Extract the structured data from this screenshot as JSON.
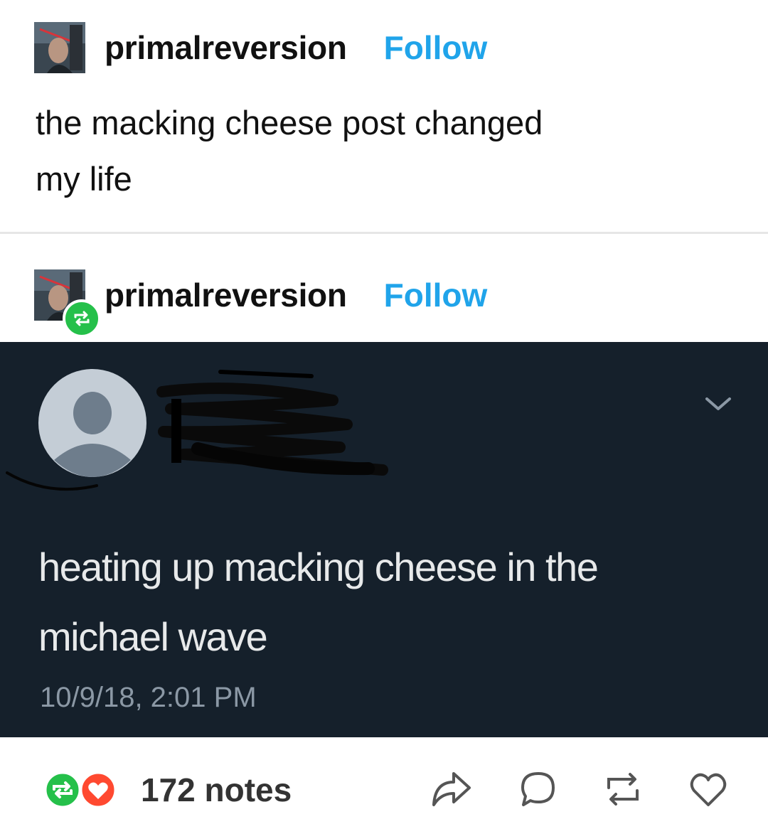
{
  "post": {
    "username": "primalreversion",
    "follow_label": "Follow",
    "text_line1": "the macking cheese post changed",
    "text_line2": "my life"
  },
  "reblog": {
    "username": "primalreversion",
    "follow_label": "Follow"
  },
  "tweet": {
    "text_line1": "heating up macking cheese in the",
    "text_line2": "michael wave",
    "timestamp": "10/9/18, 2:01 PM"
  },
  "footer": {
    "notes": "172 notes"
  },
  "colors": {
    "follow": "#20a4ea",
    "reblog_green": "#25c04a",
    "like_red": "#ff4930",
    "tweet_bg": "#15202b"
  },
  "icons": [
    "reblog-icon",
    "heart-icon",
    "share-icon",
    "reply-icon",
    "reblog-action-icon",
    "like-icon",
    "chevron-down-icon",
    "default-avatar-icon"
  ]
}
